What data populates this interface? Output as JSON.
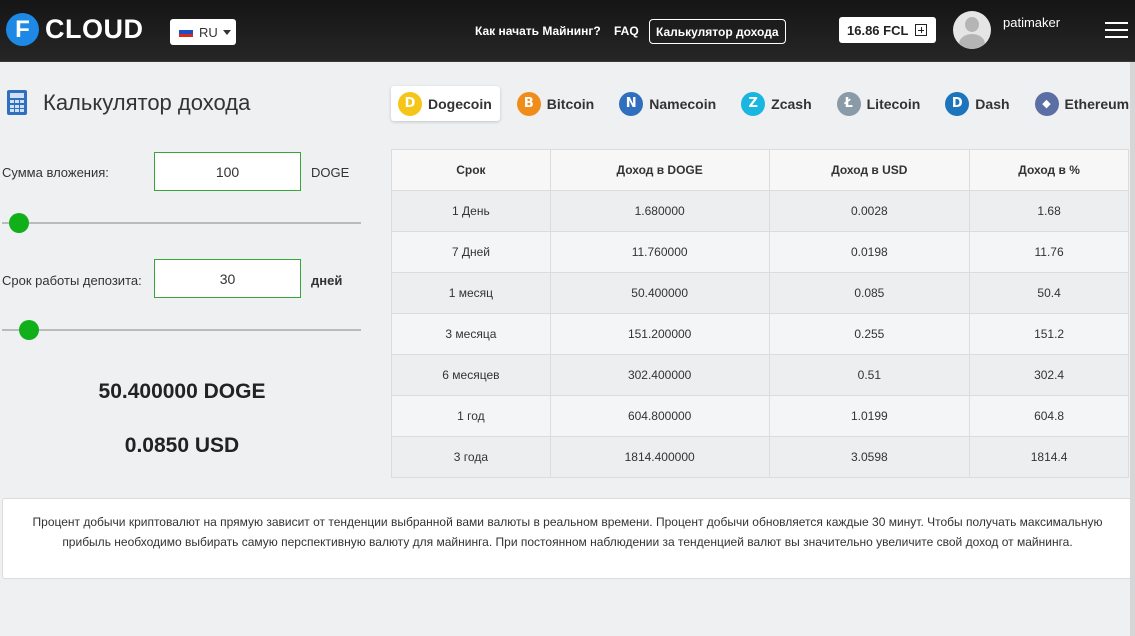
{
  "header": {
    "logo_letter": "F",
    "logo_text": "CLOUD",
    "language": "RU",
    "nav": {
      "how_to_start": "Как начать Майнинг?",
      "faq": "FAQ",
      "calculator": "Калькулятор дохода"
    },
    "balance": "16.86 FCL",
    "username": "patimaker"
  },
  "page": {
    "title": "Калькулятор дохода",
    "coins": [
      {
        "label": "Dogecoin",
        "symbol": "D",
        "color": "#f5c518"
      },
      {
        "label": "Bitcoin",
        "symbol": "B",
        "color": "#f08c1a"
      },
      {
        "label": "Namecoin",
        "symbol": "N",
        "color": "#2f6fbd"
      },
      {
        "label": "Zcash",
        "symbol": "Z",
        "color": "#19b6e0"
      },
      {
        "label": "Litecoin",
        "symbol": "Ł",
        "color": "#8a9aa6"
      },
      {
        "label": "Dash",
        "symbol": "D",
        "color": "#1c75bc"
      },
      {
        "label": "Ethereum",
        "symbol": "◆",
        "color": "#5c6fa5"
      }
    ],
    "selected_coin": "Dogecoin",
    "investment": {
      "label": "Сумма вложения:",
      "value": "100",
      "unit": "DOGE",
      "slider_level": 0.02
    },
    "term": {
      "label": "Срок работы депозита:",
      "value": "30",
      "unit": "дней",
      "slider_level": 0.05
    },
    "result_coin": "50.400000 DOGE",
    "result_usd": "0.0850 USD"
  },
  "table": {
    "headers": [
      "Срок",
      "Доход в DOGE",
      "Доход в USD",
      "Доход в %"
    ],
    "rows": [
      [
        "1 День",
        "1.680000",
        "0.0028",
        "1.68"
      ],
      [
        "7 Дней",
        "11.760000",
        "0.0198",
        "11.76"
      ],
      [
        "1 месяц",
        "50.400000",
        "0.085",
        "50.4"
      ],
      [
        "3 месяца",
        "151.200000",
        "0.255",
        "151.2"
      ],
      [
        "6 месяцев",
        "302.400000",
        "0.51",
        "302.4"
      ],
      [
        "1 год",
        "604.800000",
        "1.0199",
        "604.8"
      ],
      [
        "3 года",
        "1814.400000",
        "3.0598",
        "1814.4"
      ]
    ]
  },
  "info_text": "Процент добычи криптовалют на прямую зависит от тенденции выбранной вами валюты в реальном времени. Процент добычи обновляется каждые 30 минут. Чтобы получать максимальную прибыль необходимо выбирать самую перспективную валюту для майнинга. При постоянном наблюдении за тенденцией валют вы значительно увеличите свой доход от майнинга."
}
